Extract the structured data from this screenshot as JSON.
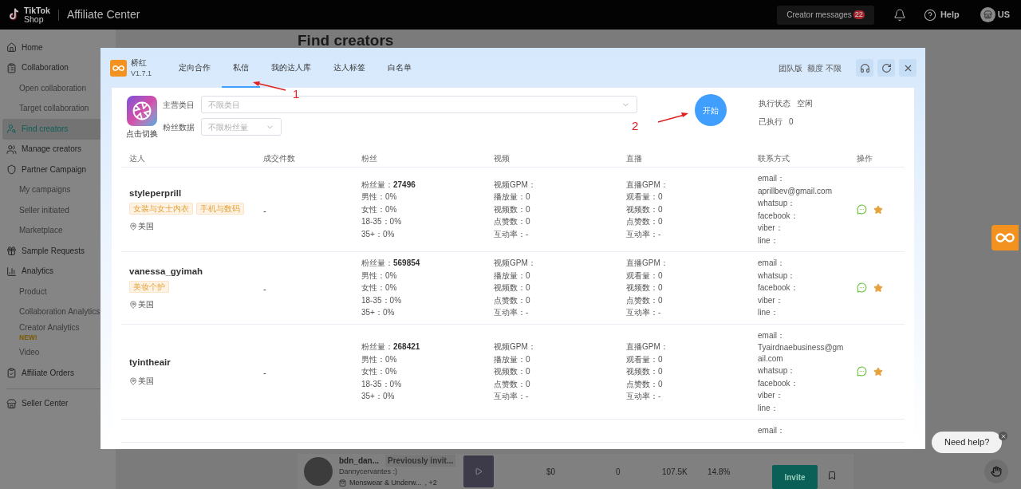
{
  "topbar": {
    "brand_top": "TikTok",
    "brand_bottom": "Shop",
    "title": "Affiliate Center",
    "messages_label": "Creator messages",
    "messages_count": "22",
    "help": "Help",
    "account": "US"
  },
  "sidebar": {
    "items": [
      {
        "label": "Home",
        "selected": false
      },
      {
        "label": "Collaboration",
        "selected": false,
        "children": [
          {
            "label": "Open collaboration",
            "selected": false
          },
          {
            "label": "Target collaboration",
            "selected": false
          }
        ]
      },
      {
        "label": "Find creators",
        "selected": true
      },
      {
        "label": "Manage creators",
        "selected": false
      },
      {
        "label": "Partner Campaign",
        "selected": false,
        "children": [
          {
            "label": "My campaigns",
            "selected": false
          },
          {
            "label": "Seller initiated",
            "selected": false
          },
          {
            "label": "Marketplace",
            "selected": false
          }
        ]
      },
      {
        "label": "Sample Requests",
        "selected": false
      },
      {
        "label": "Analytics",
        "selected": false,
        "children": [
          {
            "label": "Product",
            "selected": false
          },
          {
            "label": "Collaboration Analytics",
            "selected": false
          },
          {
            "label": "Creator Analytics",
            "badge": "NEW!",
            "selected": false
          },
          {
            "label": "Video",
            "selected": false
          }
        ]
      },
      {
        "label": "Affiliate Orders",
        "selected": false
      },
      {
        "label": "Seller Center",
        "selected": false
      }
    ]
  },
  "page": {
    "heading": "Find creators",
    "row": {
      "name": "bdn_dan...",
      "status": "Previously invit...",
      "handle": "Dannycervantes :)",
      "category": "Menswear & Underw...",
      "more": ", +2",
      "gmv": "$0",
      "items_sold": "0",
      "followers": "107.5K",
      "rate": "14.8%",
      "invite": "Invite"
    }
  },
  "modal": {
    "app_name": "桥红",
    "version": "V1.7.1",
    "tabs": [
      {
        "label": "定向合作",
        "selected": false
      },
      {
        "label": "私信",
        "selected": true
      },
      {
        "label": "我的达人库",
        "selected": false
      },
      {
        "label": "达人标签",
        "selected": false
      },
      {
        "label": "白名单",
        "selected": false
      }
    ],
    "edition": "团队版",
    "quota_label": "额度",
    "quota_value": "不限",
    "switch_label": "点击切换",
    "filters": [
      {
        "label": "主营类目",
        "placeholder": "不限类目",
        "kind": "wide"
      },
      {
        "label": "粉丝数据",
        "placeholder": "不限粉丝量",
        "kind": "narrow"
      }
    ],
    "start_button": "开始",
    "status": [
      {
        "label": "执行状态",
        "value": "空闲"
      },
      {
        "label": "已执行",
        "value": "0"
      }
    ],
    "annotations": [
      {
        "label": "1"
      },
      {
        "label": "2"
      }
    ],
    "columns": [
      "达人",
      "成交件数",
      "粉丝",
      "视频",
      "直播",
      "联系方式",
      "操作"
    ],
    "rows": [
      {
        "name": "styleperprill",
        "tags": [
          "女装与女士内衣",
          "手机与数码"
        ],
        "location": "美国",
        "deals": "-",
        "fans": [
          {
            "label": "粉丝量：",
            "value": "27496"
          },
          {
            "label": "男性：",
            "value": "0%"
          },
          {
            "label": "女性：",
            "value": "0%"
          },
          {
            "label": "18-35：",
            "value": "0%"
          },
          {
            "label": "35+：",
            "value": "0%"
          }
        ],
        "video": [
          {
            "label": "视频GPM："
          },
          {
            "label": "播放量：",
            "value": "0"
          },
          {
            "label": "视频数：",
            "value": "0"
          },
          {
            "label": "点赞数：",
            "value": "0"
          },
          {
            "label": "互动率：",
            "value": "-"
          }
        ],
        "live": [
          {
            "label": "直播GPM："
          },
          {
            "label": "观看量：",
            "value": "0"
          },
          {
            "label": "视频数：",
            "value": "0"
          },
          {
            "label": "点赞数：",
            "value": "0"
          },
          {
            "label": "互动率：",
            "value": "-"
          }
        ],
        "contact": [
          "email：",
          "aprillbev@gmail.com",
          "whatsup：",
          "facebook：",
          "viber：",
          "line："
        ]
      },
      {
        "name": "vanessa_gyimah",
        "tags": [
          "美妆个护"
        ],
        "location": "美国",
        "deals": "-",
        "fans": [
          {
            "label": "粉丝量：",
            "value": "569854"
          },
          {
            "label": "男性：",
            "value": "0%"
          },
          {
            "label": "女性：",
            "value": "0%"
          },
          {
            "label": "18-35：",
            "value": "0%"
          },
          {
            "label": "35+：",
            "value": "0%"
          }
        ],
        "video": [
          {
            "label": "视频GPM："
          },
          {
            "label": "播放量：",
            "value": "0"
          },
          {
            "label": "视频数：",
            "value": "0"
          },
          {
            "label": "点赞数：",
            "value": "0"
          },
          {
            "label": "互动率：",
            "value": "-"
          }
        ],
        "live": [
          {
            "label": "直播GPM："
          },
          {
            "label": "观看量：",
            "value": "0"
          },
          {
            "label": "视频数：",
            "value": "0"
          },
          {
            "label": "点赞数：",
            "value": "0"
          },
          {
            "label": "互动率：",
            "value": "-"
          }
        ],
        "contact": [
          "email：",
          "whatsup：",
          "facebook：",
          "viber：",
          "line："
        ]
      },
      {
        "name": "tyintheair",
        "location": "美国",
        "deals": "-",
        "fans": [
          {
            "label": "粉丝量：",
            "value": "268421"
          },
          {
            "label": "男性：",
            "value": "0%"
          },
          {
            "label": "女性：",
            "value": "0%"
          },
          {
            "label": "18-35：",
            "value": "0%"
          },
          {
            "label": "35+：",
            "value": "0%"
          }
        ],
        "video": [
          {
            "label": "视频GPM："
          },
          {
            "label": "播放量：",
            "value": "0"
          },
          {
            "label": "视频数：",
            "value": "0"
          },
          {
            "label": "点赞数：",
            "value": "0"
          },
          {
            "label": "互动率：",
            "value": "-"
          }
        ],
        "live": [
          {
            "label": "直播GPM："
          },
          {
            "label": "观看量：",
            "value": "0"
          },
          {
            "label": "视频数：",
            "value": "0"
          },
          {
            "label": "点赞数：",
            "value": "0"
          },
          {
            "label": "互动率：",
            "value": "-"
          }
        ],
        "contact": [
          "email：",
          "Tyairdnaebusiness@gmail.com",
          "whatsup：",
          "facebook：",
          "viber：",
          "line："
        ]
      },
      {
        "contact": [
          "email："
        ]
      }
    ]
  },
  "help_bubble": "Need help?"
}
